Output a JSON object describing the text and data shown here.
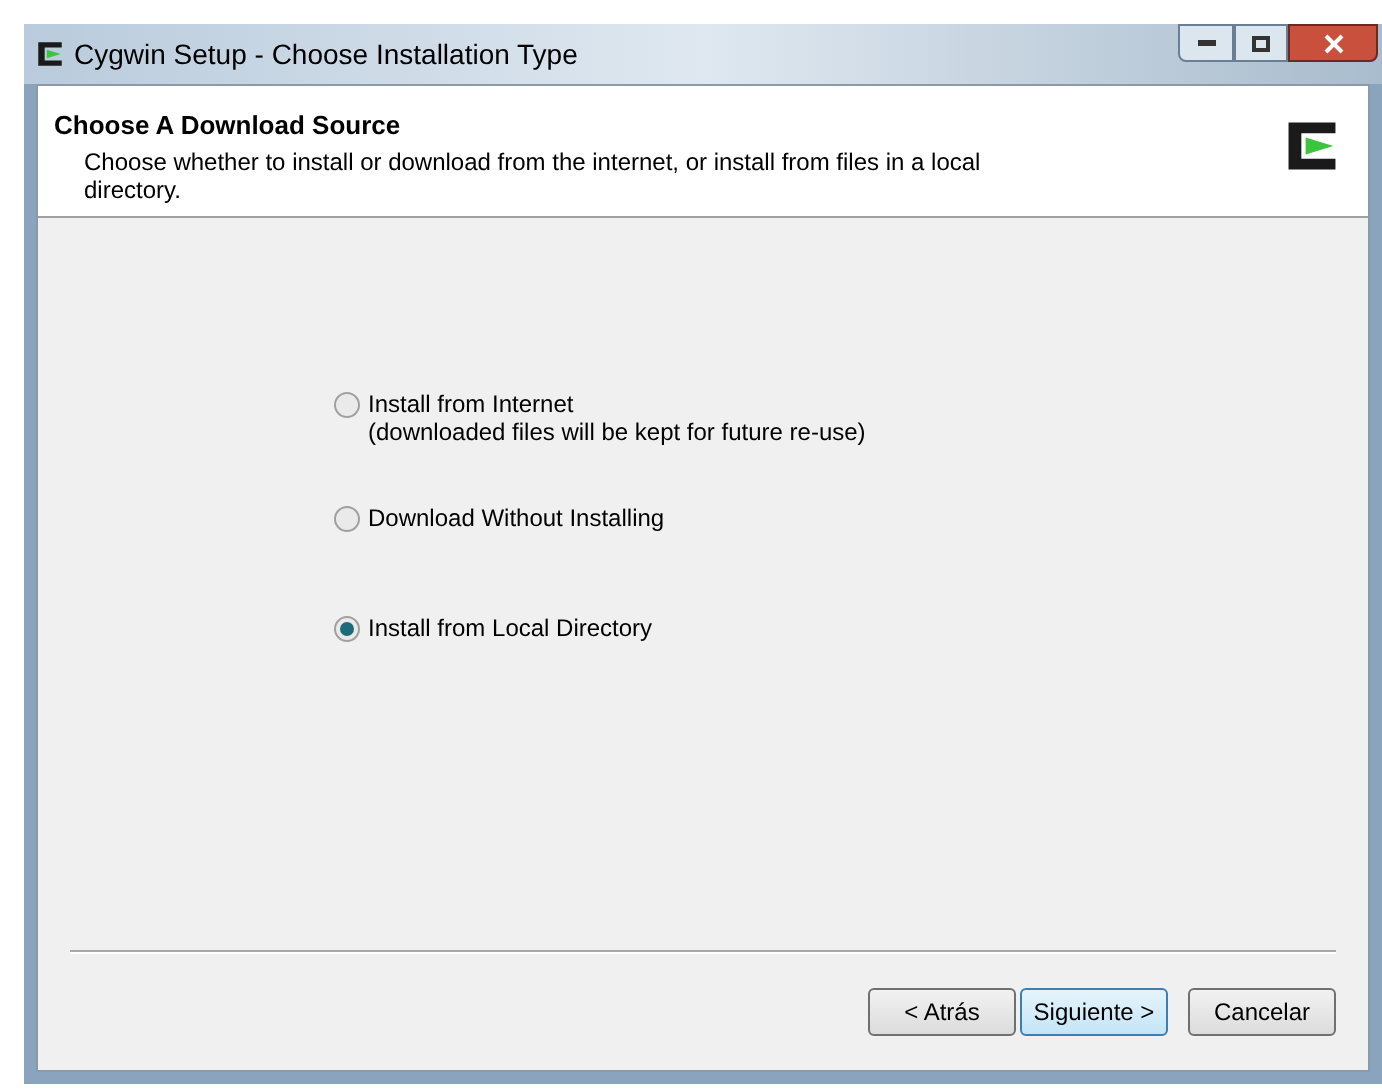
{
  "window": {
    "title": "Cygwin Setup - Choose Installation Type"
  },
  "header": {
    "title": "Choose A Download Source",
    "subtitle": "Choose whether to install or download from the internet, or install from files in a local directory."
  },
  "options": [
    {
      "label": "Install from Internet",
      "note": "(downloaded files will be kept for future re-use)",
      "selected": false
    },
    {
      "label": "Download Without Installing",
      "selected": false
    },
    {
      "label": "Install from Local Directory",
      "selected": true
    }
  ],
  "buttons": [
    {
      "label": "< Atrás",
      "default": false
    },
    {
      "label": "Siguiente >",
      "default": true
    },
    {
      "label": "Cancelar",
      "default": false
    }
  ]
}
